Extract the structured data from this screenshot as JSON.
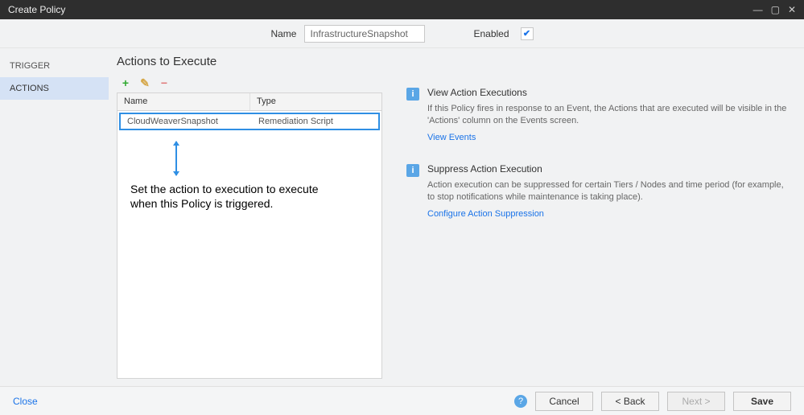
{
  "window": {
    "title": "Create Policy"
  },
  "header": {
    "name_label": "Name",
    "name_value": "InfrastructureSnapshot",
    "enabled_label": "Enabled",
    "enabled_checked": true
  },
  "sidebar": {
    "items": [
      {
        "label": "TRIGGER",
        "active": false
      },
      {
        "label": "ACTIONS",
        "active": true
      }
    ]
  },
  "actions_panel": {
    "title": "Actions to Execute",
    "columns": {
      "name": "Name",
      "type": "Type"
    },
    "rows": [
      {
        "name": "CloudWeaverSnapshot",
        "type": "Remediation Script"
      }
    ],
    "callout": "Set the action to execution to execute when this Policy is triggered."
  },
  "info_panels": [
    {
      "title": "View Action Executions",
      "desc": "If this Policy fires in response to an Event, the Actions that are executed will be visible in the 'Actions' column on the Events screen.",
      "link": "View Events"
    },
    {
      "title": "Suppress Action Execution",
      "desc": "Action execution can be suppressed for certain Tiers / Nodes and time period (for example, to stop notifications while maintenance is taking place).",
      "link": "Configure Action Suppression"
    }
  ],
  "footer": {
    "close": "Close",
    "cancel": "Cancel",
    "back": "< Back",
    "next": "Next >",
    "save": "Save"
  }
}
